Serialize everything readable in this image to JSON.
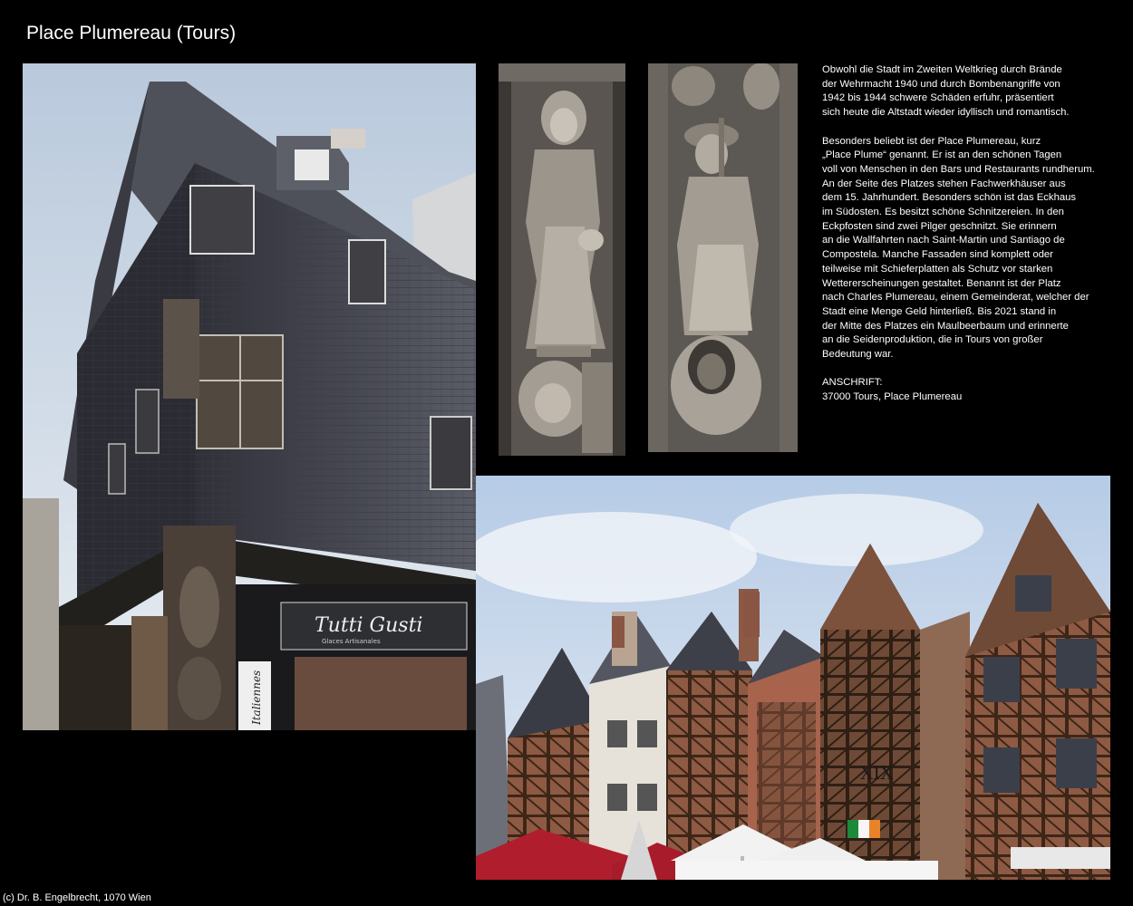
{
  "page": {
    "title": "Place Plumereau (Tours)",
    "credit": "(c) Dr. B. Engelbrecht, 1070 Wien"
  },
  "photos": {
    "house": {
      "description_icon": "half-timbered-slate-house-photo",
      "shop_sign": "Tutti Gusti",
      "shop_subsign": "Glaces Artisanales",
      "side_banner": "Italiennes"
    },
    "pilgrim_1": {
      "description_icon": "carved-pilgrim-statue-photo"
    },
    "pilgrim_2": {
      "description_icon": "carved-pilgrim-statue-photo"
    },
    "square": {
      "description_icon": "half-timbered-houses-square-photo",
      "facade_mark": "XIX"
    }
  },
  "text": {
    "paragraph_1": [
      "Obwohl die Stadt im Zweiten Weltkrieg durch Brände",
      "der Wehrmacht 1940 und durch Bombenangriffe von",
      "1942 bis 1944 schwere Schäden erfuhr, präsentiert",
      "sich heute die Altstadt wieder idyllisch und romantisch."
    ],
    "paragraph_2": [
      "Besonders beliebt ist der Place Plumereau, kurz",
      "„Place Plume“ genannt. Er ist an den schönen Tagen",
      "voll von Menschen in den Bars und Restaurants rundherum.",
      "An der Seite des Platzes stehen Fachwerkhäuser aus",
      "dem 15. Jahrhundert. Besonders schön ist das Eckhaus",
      "im Südosten. Es besitzt schöne Schnitzereien. In den",
      "Eckpfosten sind zwei Pilger geschnitzt. Sie erinnern",
      "an die Wallfahrten nach Saint-Martin und Santiago de",
      "Compostela. Manche Fassaden sind komplett oder",
      "teilweise mit Schieferplatten als Schutz vor starken",
      "Wettererscheinungen gestaltet. Benannt ist der Platz",
      "nach Charles Plumereau, einem Gemeinderat, welcher der",
      "Stadt eine Menge Geld hinterließ. Bis 2021 stand in",
      "der Mitte des Platzes ein Maulbeerbaum und erinnerte",
      "an die Seidenproduktion, die in Tours von großer",
      "Bedeutung war."
    ],
    "address_label": "ANSCHRIFT:",
    "address_value": "37000 Tours, Place Plumereau"
  },
  "colors": {
    "background": "#000000",
    "text": "#ffffff",
    "slate": "#4b4d56",
    "timber": "#5a3f2c",
    "sky": "#c9d8ea",
    "umbrella_red": "#b01e2e"
  }
}
